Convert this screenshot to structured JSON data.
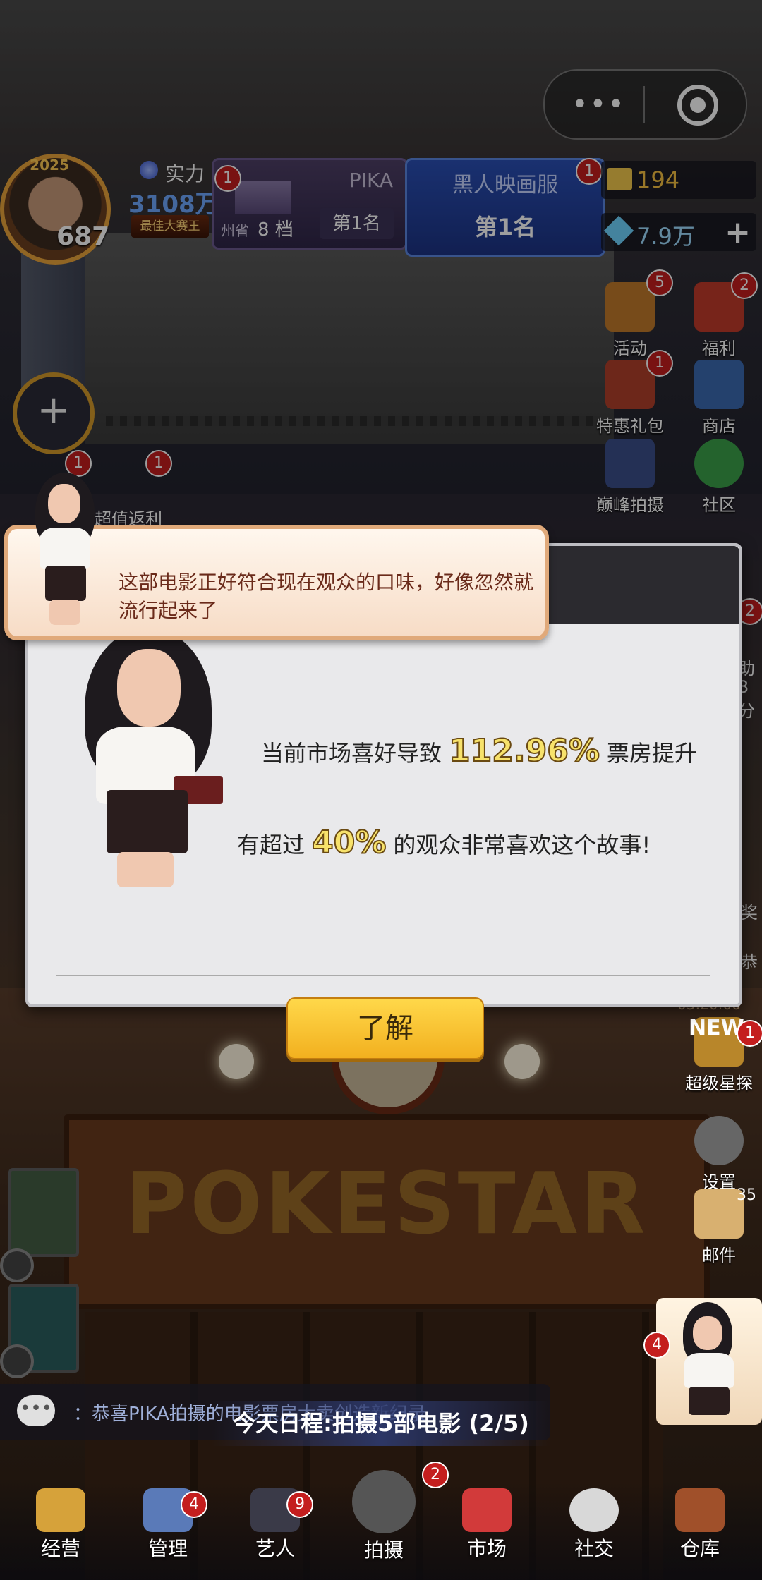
{
  "capsule": {
    "more_glyph": "•••"
  },
  "player": {
    "level": "687",
    "power_label": "实力",
    "power_value": "3108万",
    "avatar_ribbon": "2025",
    "title_badge": "最佳大赛王"
  },
  "pika_panel": {
    "name": "PIKA",
    "city": "州省",
    "tier": "8 档",
    "rank": "第1名",
    "badge": "1"
  },
  "film_panel": {
    "name": "黑人映画服",
    "rank": "第1名",
    "badge": "1"
  },
  "resources": {
    "tickets": "194",
    "gems": "7.9万",
    "add": "+"
  },
  "plus_button": "+",
  "side_right": [
    {
      "label": "活动",
      "badge": "5",
      "color": "#c07a2a"
    },
    {
      "label": "福利",
      "badge": "2",
      "color": "#c03a2a"
    },
    {
      "label": "特惠礼包",
      "badge": "1",
      "color": "#b0402a"
    },
    {
      "label": "商店",
      "badge": "",
      "color": "#3a6ab0"
    },
    {
      "label": "巅峰拍摄",
      "badge": "",
      "color": "#3a4e8a"
    },
    {
      "label": "社区",
      "badge": "",
      "color": "#3aa04a"
    }
  ],
  "side_left": {
    "badge_a": "1",
    "badge_b": "1",
    "label": "超值返利"
  },
  "bubble": {
    "text": "这部电影正好符合现在观众的口味，好像忽然就流行起来了"
  },
  "dialog": {
    "line1_prefix": "当前市场喜好导致",
    "line1_value": "112.96%",
    "line1_suffix": "票房提升",
    "line2_prefix": "有超过",
    "line2_value": "40%",
    "line2_suffix": "的观众非常喜欢这个故事!",
    "ok_label": "了解"
  },
  "right_lower": [
    {
      "label": "超级星探",
      "badge": "1",
      "tag": "NEW"
    },
    {
      "label": "设置",
      "badge": ""
    },
    {
      "label": "邮件",
      "badge": "35"
    }
  ],
  "partials": {
    "right_badge": "2",
    "a": "助",
    "b": "3分",
    "c": "奖",
    "d": "恭",
    "timer": "03:20:00"
  },
  "marquee": "POKESTAR",
  "girl_badge": "4",
  "chat": {
    "icon": "•••",
    "text": "：恭喜PIKA拍摄的电影票房大卖创造新纪录"
  },
  "schedule": "今天日程:拍摄5部电影 (2/5)",
  "nav": [
    {
      "label": "经营",
      "badge": "",
      "color": "#d6a23a"
    },
    {
      "label": "管理",
      "badge": "4",
      "color": "#5a7ab8"
    },
    {
      "label": "艺人",
      "badge": "9",
      "color": "#3a3a48"
    },
    {
      "label": "拍摄",
      "badge": "2",
      "color": "#555"
    },
    {
      "label": "市场",
      "badge": "",
      "color": "#d23a3a"
    },
    {
      "label": "社交",
      "badge": "",
      "color": "#d8d8d8"
    },
    {
      "label": "仓库",
      "badge": "",
      "color": "#a0502a"
    }
  ]
}
